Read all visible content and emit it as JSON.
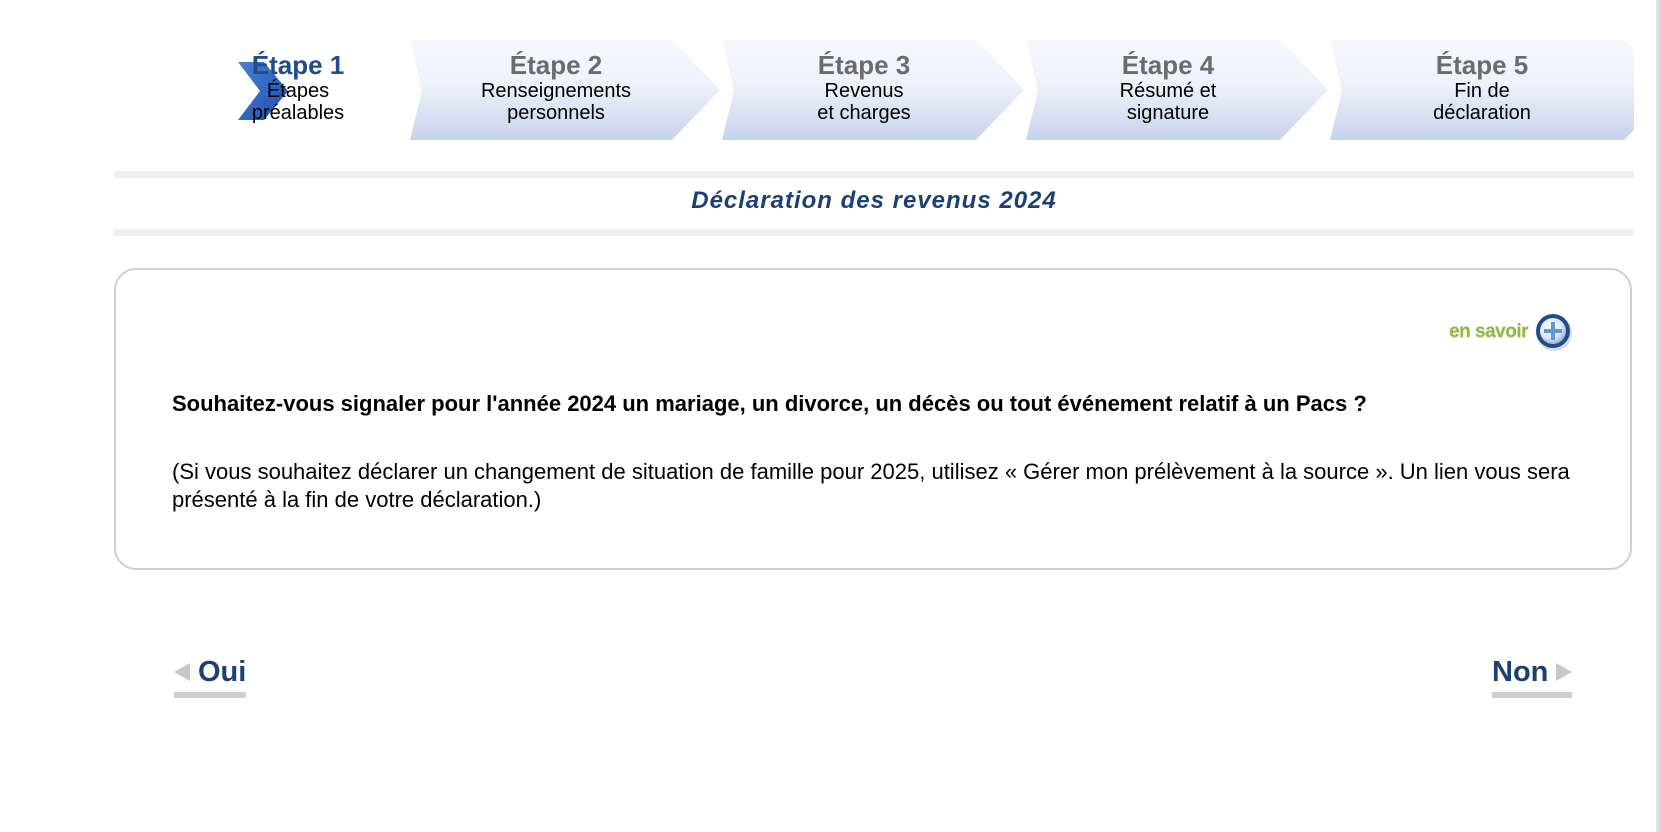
{
  "steps": [
    {
      "title": "Étape 1",
      "subtitle": "Étapes\npréalables",
      "active": true
    },
    {
      "title": "Étape 2",
      "subtitle": "Renseignements\npersonnels",
      "active": false
    },
    {
      "title": "Étape 3",
      "subtitle": "Revenus\net charges",
      "active": false
    },
    {
      "title": "Étape 4",
      "subtitle": "Résumé et\nsignature",
      "active": false
    },
    {
      "title": "Étape 5",
      "subtitle": "Fin de\ndéclaration",
      "active": false
    }
  ],
  "page_title": "Déclaration des revenus 2024",
  "card": {
    "info_link_label": "en savoir",
    "question": "Souhaitez-vous signaler pour l'année 2024 un mariage, un divorce, un décès ou tout événement relatif à un Pacs ?",
    "note": "(Si vous souhaitez déclarer un changement de situation de famille pour 2025, utilisez « Gérer mon prélèvement à la source ». Un lien vous sera présenté à la fin de votre déclaration.)"
  },
  "navigation": {
    "yes_label": "Oui",
    "no_label": "Non"
  },
  "icons": {
    "current_step": "chevron-right-icon",
    "info": "plus-circle-icon",
    "yes_arrow": "triangle-left-icon",
    "no_arrow": "triangle-right-icon"
  },
  "colors": {
    "active_step": "#1f4b8f",
    "inactive_step": "#6b6b6b",
    "title": "#1c3f74",
    "info_green": "#8cbb3c",
    "nav_link": "#1c3f74"
  }
}
